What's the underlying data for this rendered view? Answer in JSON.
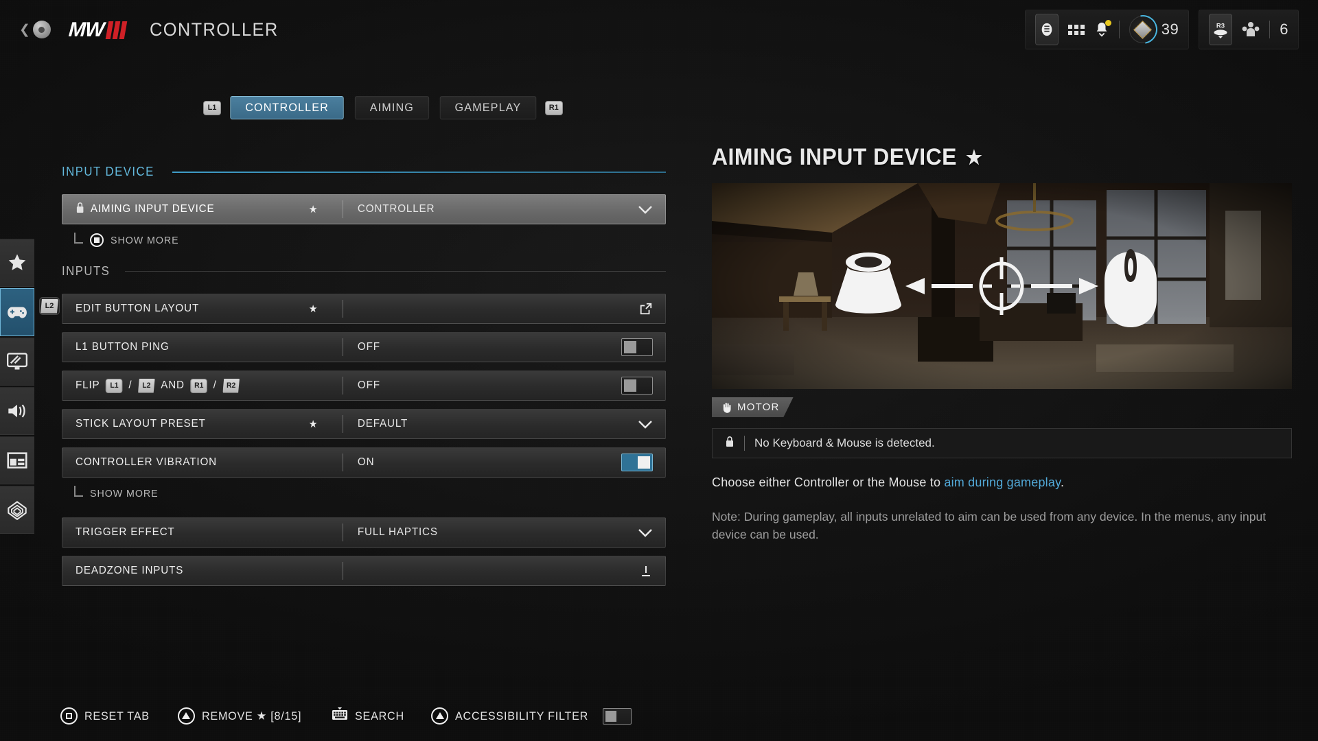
{
  "header": {
    "back_icon": "back-arrow-circle-icon",
    "logo_text": "MW",
    "title": "CONTROLLER"
  },
  "hud": {
    "battery_icon": "battery-icon",
    "grid_icon": "apps-grid-icon",
    "bell_icon": "notification-bell-icon",
    "rank_icon": "rank-emblem-icon",
    "rank_value": "39",
    "r3_hint": "R3",
    "squad_icon": "squad-members-icon",
    "squad_value": "6"
  },
  "sidebar": {
    "items": [
      {
        "name": "favorites",
        "icon": "star-icon"
      },
      {
        "name": "controller",
        "icon": "gamepad-icon",
        "active": true,
        "hint": "L2"
      },
      {
        "name": "graphics",
        "icon": "monitor-icon"
      },
      {
        "name": "audio",
        "icon": "speaker-icon"
      },
      {
        "name": "interface",
        "icon": "layout-icon"
      },
      {
        "name": "account",
        "icon": "network-icon"
      }
    ]
  },
  "tabs": {
    "left_hint": "L1",
    "right_hint": "R1",
    "items": [
      {
        "label": "CONTROLLER",
        "active": true
      },
      {
        "label": "AIMING",
        "active": false
      },
      {
        "label": "GAMEPLAY",
        "active": false
      }
    ]
  },
  "settings": {
    "sections": [
      {
        "title": "INPUT DEVICE",
        "accent": true,
        "rows": [
          {
            "label": "AIMING INPUT DEVICE",
            "value": "CONTROLLER",
            "control": "dropdown",
            "star": true,
            "lock": true,
            "selected": true
          }
        ],
        "sub": {
          "label": "SHOW MORE",
          "glyph": "square-button-icon"
        }
      },
      {
        "title": "INPUTS",
        "accent": false,
        "rows": [
          {
            "label": "EDIT BUTTON LAYOUT",
            "value": "",
            "control": "external",
            "star": true
          },
          {
            "label": "L1 BUTTON PING",
            "value": "OFF",
            "control": "toggle",
            "toggle_on": false
          },
          {
            "label": "FLIP",
            "value": "OFF",
            "control": "toggle",
            "toggle_on": false,
            "badges": [
              "L1",
              "L2",
              "AND",
              "R1",
              "R2"
            ]
          },
          {
            "label": "STICK LAYOUT PRESET",
            "value": "DEFAULT",
            "control": "dropdown",
            "star": true
          },
          {
            "label": "CONTROLLER VIBRATION",
            "value": "ON",
            "control": "toggle",
            "toggle_on": true
          }
        ],
        "sub2": {
          "label": "SHOW MORE"
        },
        "rows2": [
          {
            "label": "TRIGGER EFFECT",
            "value": "FULL HAPTICS",
            "control": "dropdown"
          },
          {
            "label": "DEADZONE INPUTS",
            "value": "",
            "control": "expand"
          }
        ]
      }
    ]
  },
  "panel": {
    "title": "AIMING INPUT DEVICE",
    "starred": true,
    "preview_icons": {
      "left": "analog-stick-icon",
      "center": "crosshair-icon",
      "right": "mouse-icon"
    },
    "tag": {
      "label": "MOTOR",
      "icon": "hand-icon"
    },
    "info": {
      "icon": "lock-icon",
      "text": "No Keyboard & Mouse is detected."
    },
    "description_prefix": "Choose either Controller or the Mouse to ",
    "description_link": "aim during gameplay",
    "description_suffix": ".",
    "note": "Note: During gameplay, all inputs unrelated to aim can be used from any device. In the menus, any input device can be used."
  },
  "footer": {
    "items": [
      {
        "label": "RESET TAB",
        "glyph": "square-button-icon"
      },
      {
        "label": "REMOVE ★ [8/15]",
        "glyph": "triangle-button-icon"
      },
      {
        "label": "SEARCH",
        "glyph": "keyboard-icon"
      },
      {
        "label": "ACCESSIBILITY FILTER",
        "glyph": "triangle-button-icon",
        "toggle": false
      }
    ]
  },
  "colors": {
    "accent_blue": "#52a9d8",
    "tab_active": "#4b7f9e",
    "brand_red": "#cf2026",
    "background": "#121212"
  }
}
